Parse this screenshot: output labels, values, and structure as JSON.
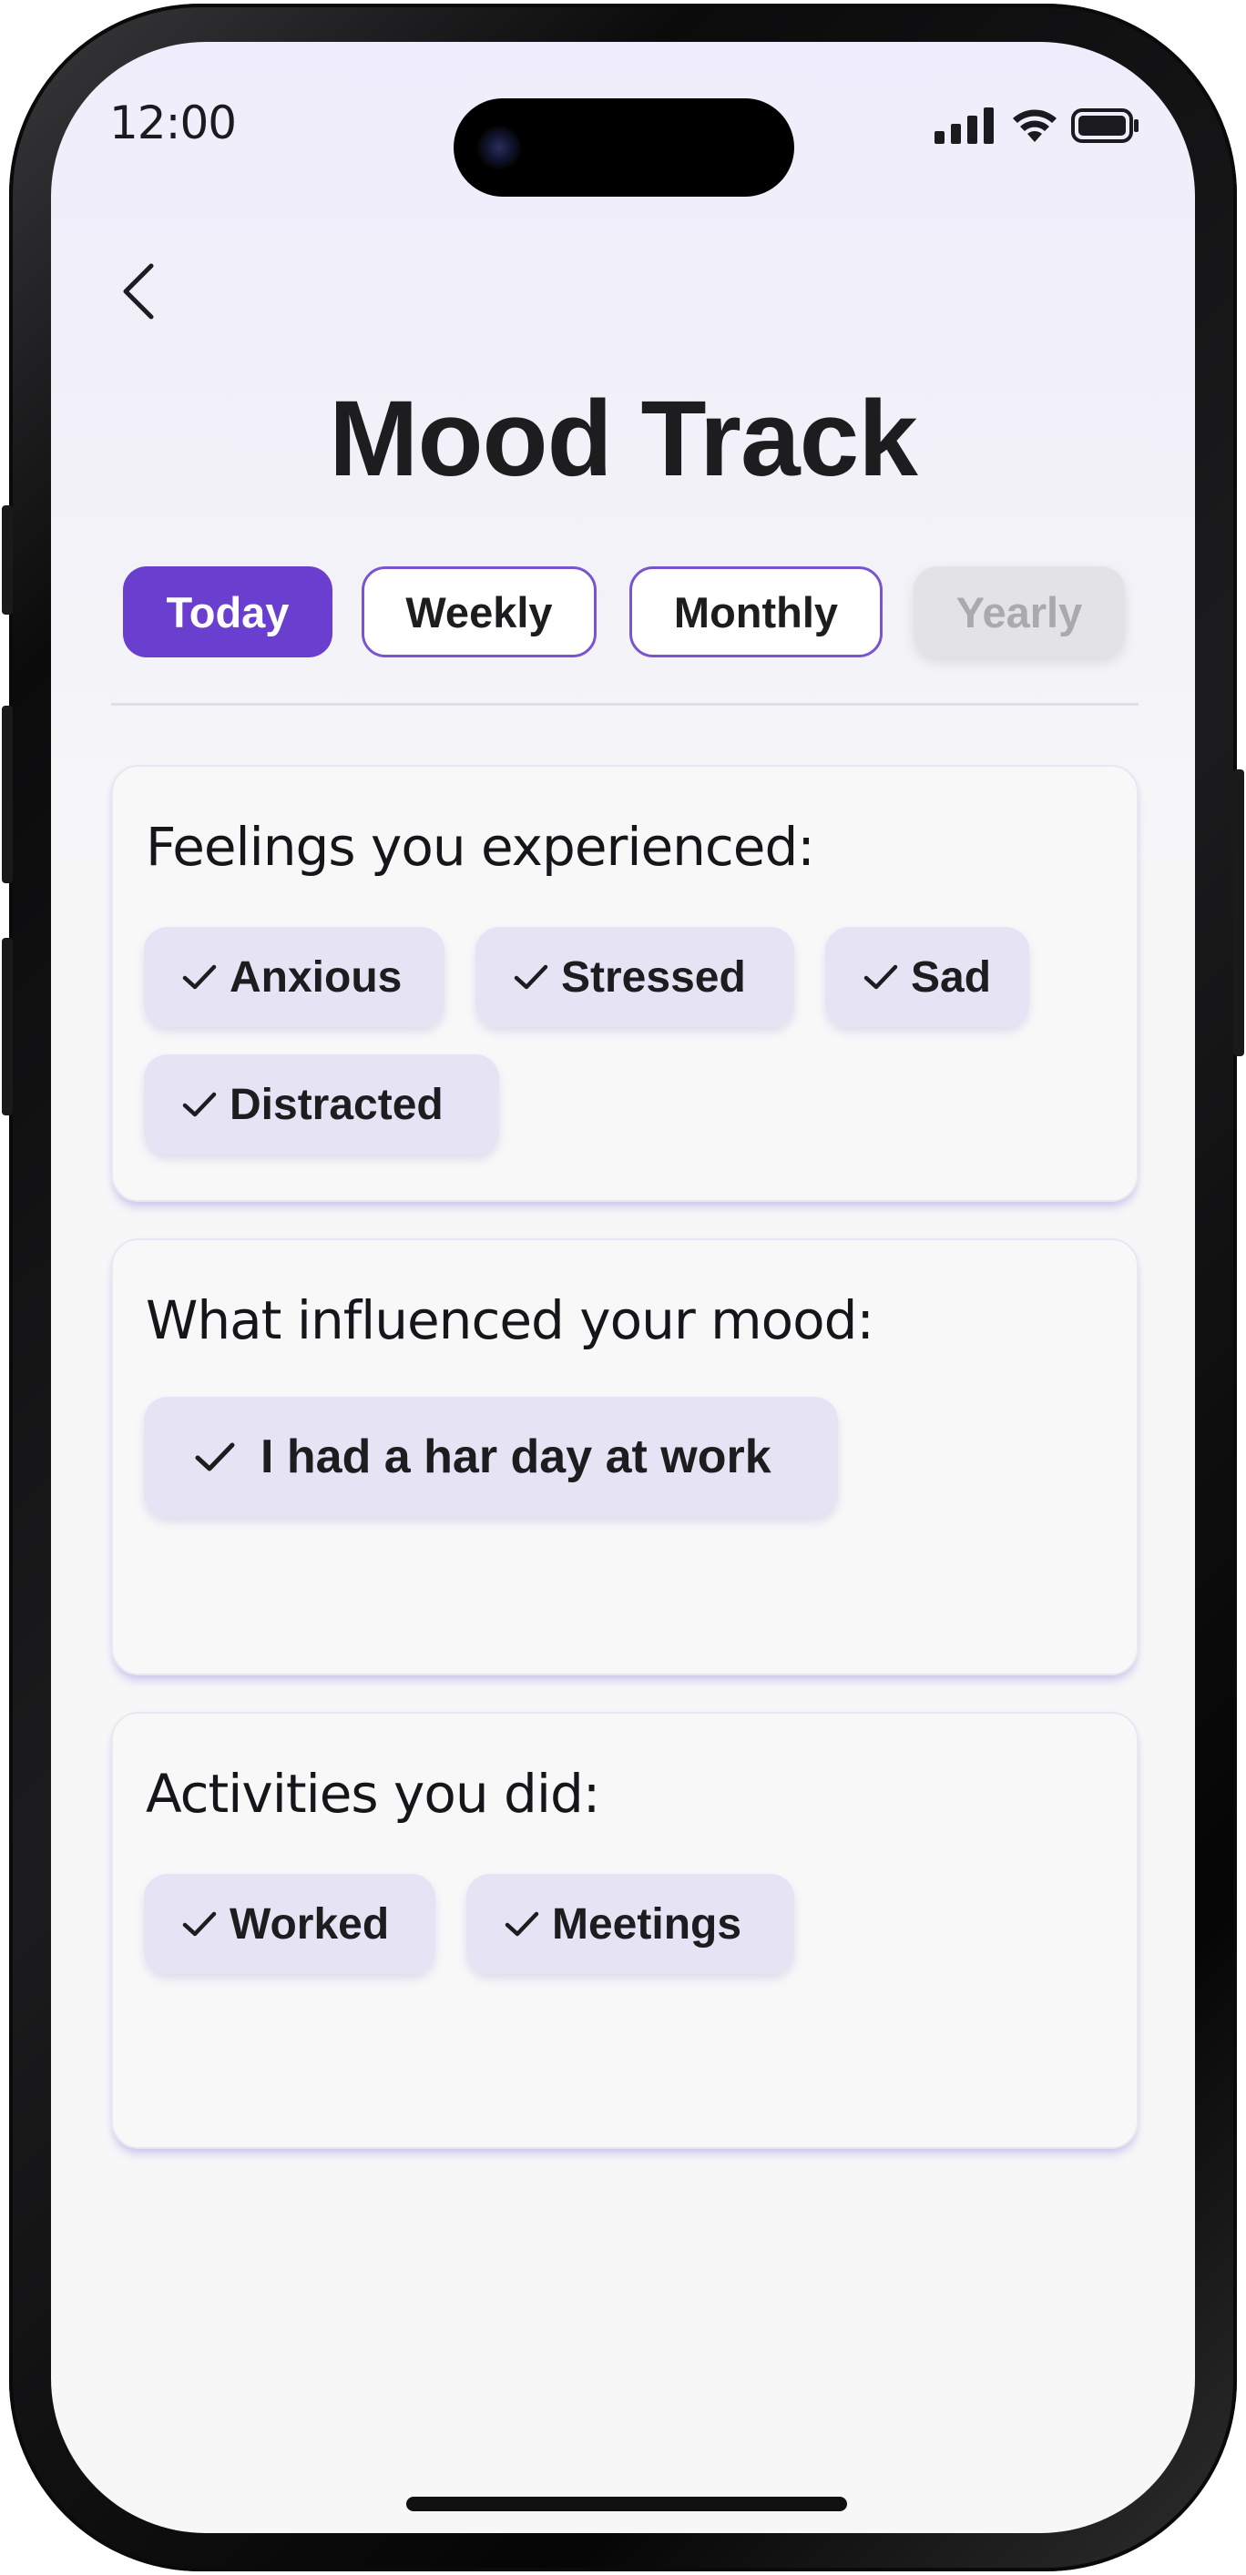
{
  "status_bar": {
    "time": "12:00"
  },
  "header": {
    "title": "Mood Track"
  },
  "tabs": [
    {
      "label": "Today",
      "state": "active"
    },
    {
      "label": "Weekly",
      "state": "default"
    },
    {
      "label": "Monthly",
      "state": "default"
    },
    {
      "label": "Yearly",
      "state": "disabled"
    }
  ],
  "feelings": {
    "title": "Feelings you experienced:",
    "chips": [
      "Anxious",
      "Stressed",
      "Sad",
      "Distracted"
    ]
  },
  "influence": {
    "title": "What influenced your mood:",
    "chips": [
      "I had a har day at work"
    ]
  },
  "activities": {
    "title": "Activities you did:",
    "chips": [
      "Worked",
      "Meetings"
    ]
  },
  "colors": {
    "accent": "#6a3fd0",
    "chip_bg": "#e6e3f5",
    "tab_outline": "#7a54cf",
    "disabled_bg": "#e3e3e6"
  },
  "icons": [
    "back-arrow-icon",
    "cellular-signal-icon",
    "wifi-icon",
    "battery-icon",
    "checkmark-icon"
  ]
}
